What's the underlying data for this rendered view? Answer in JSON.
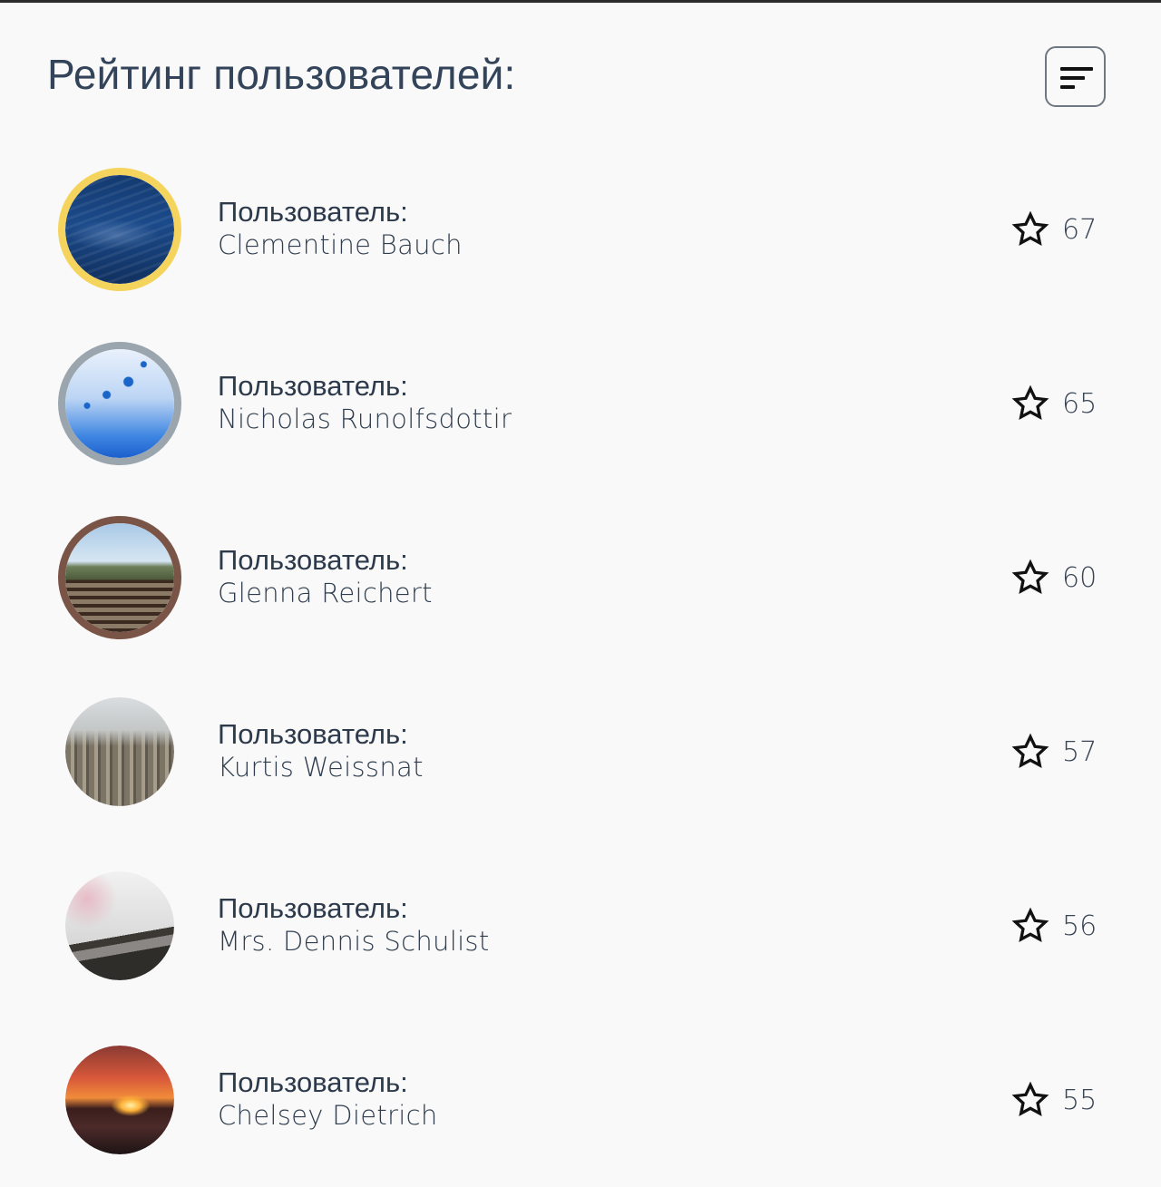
{
  "header": {
    "title": "Рейтинг пользователей:"
  },
  "icons": {
    "sort": "sort-lines-icon",
    "star": "star-outline-icon"
  },
  "colors": {
    "background": "#f9f9f9",
    "text": "#2f3b4c",
    "gold_ring": "#f5d45e",
    "silver_ring": "#9aa5ae",
    "bronze_ring": "#7a5447"
  },
  "users": [
    {
      "label": "Пользователь:",
      "name": "Clementine Bauch",
      "rating": "67",
      "ring": "gold",
      "avatar": "sea"
    },
    {
      "label": "Пользователь:",
      "name": "Nicholas Runolfsdottir",
      "rating": "65",
      "ring": "silver",
      "avatar": "jellyfish"
    },
    {
      "label": "Пользователь:",
      "name": "Glenna Reichert",
      "rating": "60",
      "ring": "bronze",
      "avatar": "railway"
    },
    {
      "label": "Пользователь:",
      "name": "Kurtis Weissnat",
      "rating": "57",
      "ring": "none",
      "avatar": "city"
    },
    {
      "label": "Пользователь:",
      "name": "Mrs. Dennis Schulist",
      "rating": "56",
      "ring": "none",
      "avatar": "turntable"
    },
    {
      "label": "Пользователь:",
      "name": "Chelsey Dietrich",
      "rating": "55",
      "ring": "none",
      "avatar": "sunset"
    }
  ]
}
